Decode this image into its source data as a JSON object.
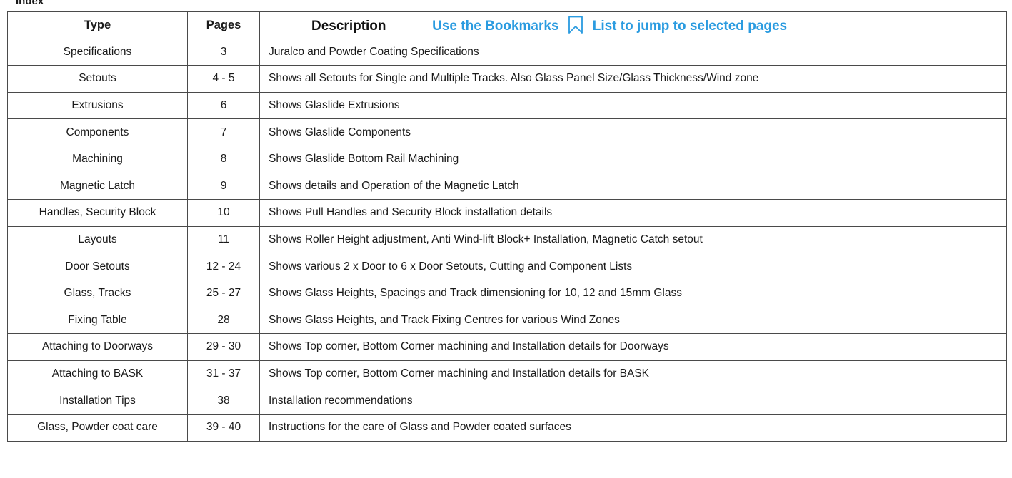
{
  "index_label": "Index",
  "header": {
    "type": "Type",
    "pages": "Pages",
    "description": "Description",
    "hint_before": "Use the Bookmarks",
    "hint_after": "List to jump to selected pages",
    "hint_color": "#2a9be0",
    "hint_icon": "bookmark-icon"
  },
  "rows": [
    {
      "type": "Specifications",
      "pages": "3",
      "description": "Juralco and Powder Coating Specifications"
    },
    {
      "type": "Setouts",
      "pages": "4  - 5",
      "description": "Shows all Setouts for Single and Multiple Tracks. Also Glass Panel Size/Glass Thickness/Wind zone"
    },
    {
      "type": "Extrusions",
      "pages": "6",
      "description": "Shows  Glaslide Extrusions"
    },
    {
      "type": "Components",
      "pages": "7",
      "description": "Shows  Glaslide Components"
    },
    {
      "type": "Machining",
      "pages": "8",
      "description": "Shows  Glaslide Bottom Rail Machining"
    },
    {
      "type": "Magnetic Latch",
      "pages": "9",
      "description": "Shows details and Operation of the Magnetic Latch"
    },
    {
      "type": "Handles, Security Block",
      "pages": "10",
      "description": "Shows Pull Handles and Security Block installation details"
    },
    {
      "type": "Layouts",
      "pages": "11",
      "description": "Shows Roller Height adjustment, Anti Wind-lift Block+ Installation, Magnetic Catch setout"
    },
    {
      "type": "Door Setouts",
      "pages": "12 - 24",
      "description": "Shows  various 2 x Door to 6 x Door Setouts, Cutting and Component Lists"
    },
    {
      "type": "Glass, Tracks",
      "pages": "25 - 27",
      "description": "Shows Glass Heights, Spacings and Track dimensioning for 10, 12 and 15mm Glass"
    },
    {
      "type": "Fixing Table",
      "pages": "28",
      "description": "Shows Glass Heights, and Track Fixing Centres for various Wind Zones"
    },
    {
      "type": "Attaching to Doorways",
      "pages": "29 - 30",
      "description": "Shows Top corner, Bottom Corner machining and Installation details for Doorways"
    },
    {
      "type": "Attaching to BASK",
      "pages": "31 - 37",
      "description": "Shows Top corner, Bottom Corner machining and Installation details for BASK"
    },
    {
      "type": "Installation Tips",
      "pages": "38",
      "description": "Installation recommendations"
    },
    {
      "type": "Glass, Powder coat care",
      "pages": "39 - 40",
      "description": "Instructions for the care of Glass and Powder coated surfaces"
    }
  ]
}
